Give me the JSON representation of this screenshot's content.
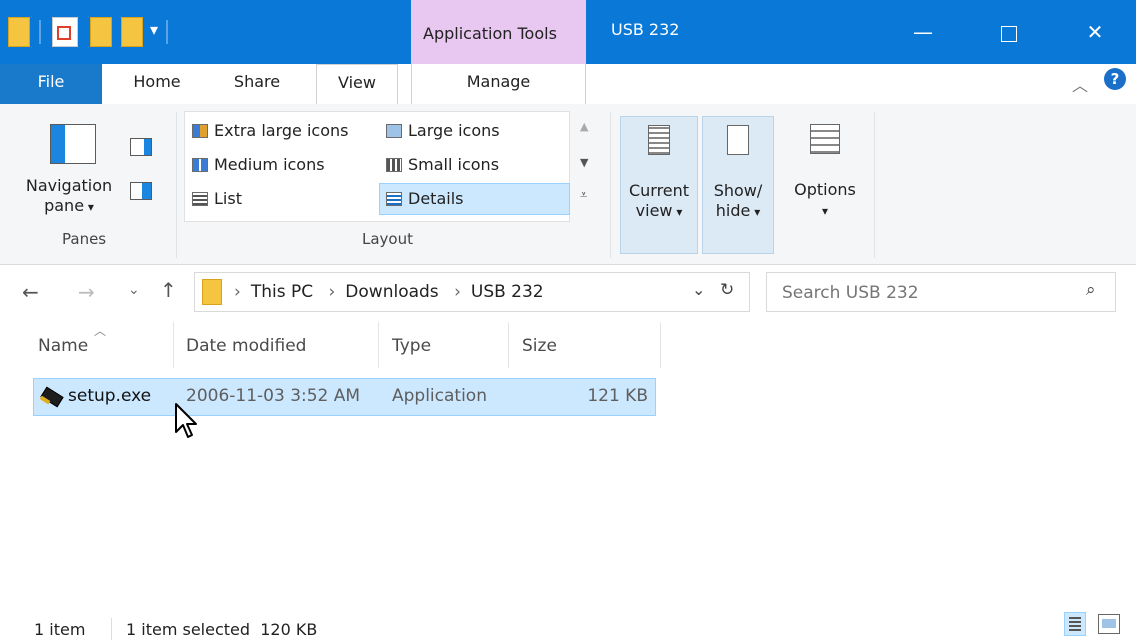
{
  "titlebar": {
    "context_tab": "Application Tools",
    "title": "USB 232",
    "minimize_icon": "minimize-icon",
    "maximize_icon": "maximize-icon",
    "close_icon": "close-icon"
  },
  "ribbon_tabs": {
    "file": "File",
    "home": "Home",
    "share": "Share",
    "view": "View",
    "manage": "Manage"
  },
  "ribbon": {
    "panes": {
      "navigation_pane": "Navigation",
      "navigation_pane_2": "pane",
      "label": "Panes"
    },
    "layout": {
      "extra_large_icons": "Extra large icons",
      "large_icons": "Large icons",
      "medium_icons": "Medium icons",
      "small_icons": "Small icons",
      "list": "List",
      "details": "Details",
      "label": "Layout"
    },
    "current_view": {
      "line1": "Current",
      "line2": "view"
    },
    "show_hide": {
      "line1": "Show/",
      "line2": "hide"
    },
    "options": {
      "label": "Options"
    }
  },
  "address": {
    "crumbs": [
      "This PC",
      "Downloads",
      "USB 232"
    ],
    "separator": "›",
    "search_placeholder": "Search USB 232"
  },
  "columns": {
    "name": "Name",
    "date_modified": "Date modified",
    "type": "Type",
    "size": "Size"
  },
  "files": [
    {
      "name": "setup.exe",
      "date": "2006-11-03 3:52 AM",
      "type": "Application",
      "size": "121 KB"
    }
  ],
  "status": {
    "count": "1 item",
    "selection": "1 item selected  120 KB"
  },
  "colors": {
    "titlebar": "#0a78d7",
    "context_tab": "#e8c8f0",
    "selection": "#cce8ff"
  }
}
